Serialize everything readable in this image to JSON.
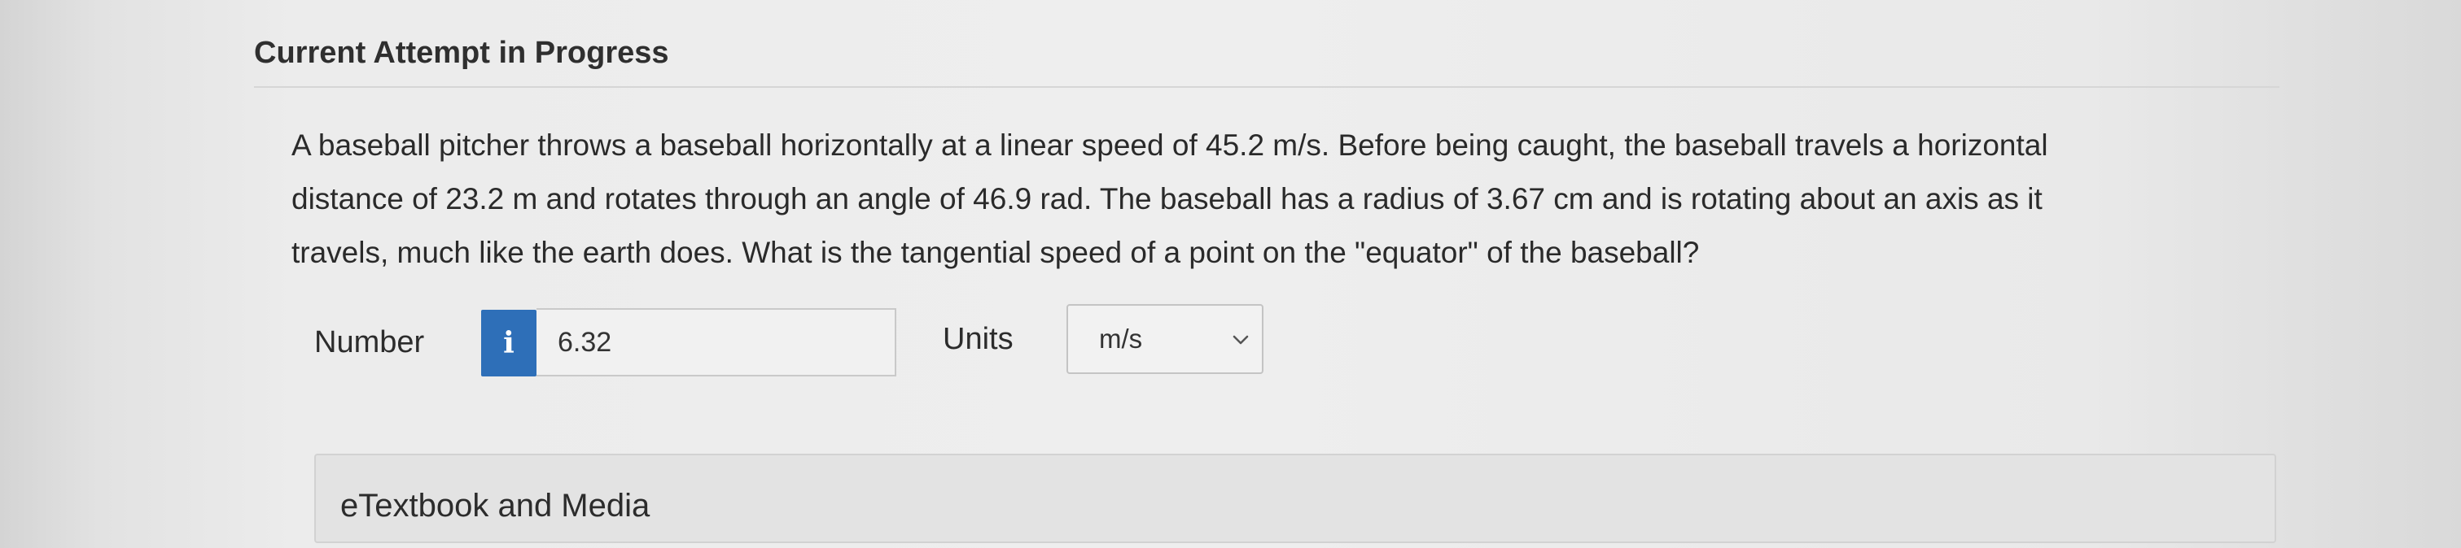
{
  "section": {
    "title": "Current Attempt in Progress"
  },
  "question": {
    "lines": [
      "A baseball pitcher throws a baseball horizontally at a linear speed of 45.2 m/s. Before being caught, the baseball travels a horizontal",
      "distance of 23.2 m and rotates through an angle of 46.9 rad. The baseball has a radius of 3.67 cm and is rotating about an axis as it",
      "travels, much like the earth does. What is the tangential speed of a point on the \"equator\" of the baseball?"
    ]
  },
  "answer": {
    "number_label": "Number",
    "info_glyph": "i",
    "info_icon": "info-icon",
    "number_value": "6.32",
    "units_label": "Units",
    "units_selected": "m/s",
    "units_icon": "chevron-down-icon"
  },
  "resources": {
    "etextbook_label": "eTextbook and Media"
  },
  "colors": {
    "info_button_bg": "#2e6fb8",
    "background": "#eeeeee",
    "text": "#2b2b2b"
  }
}
